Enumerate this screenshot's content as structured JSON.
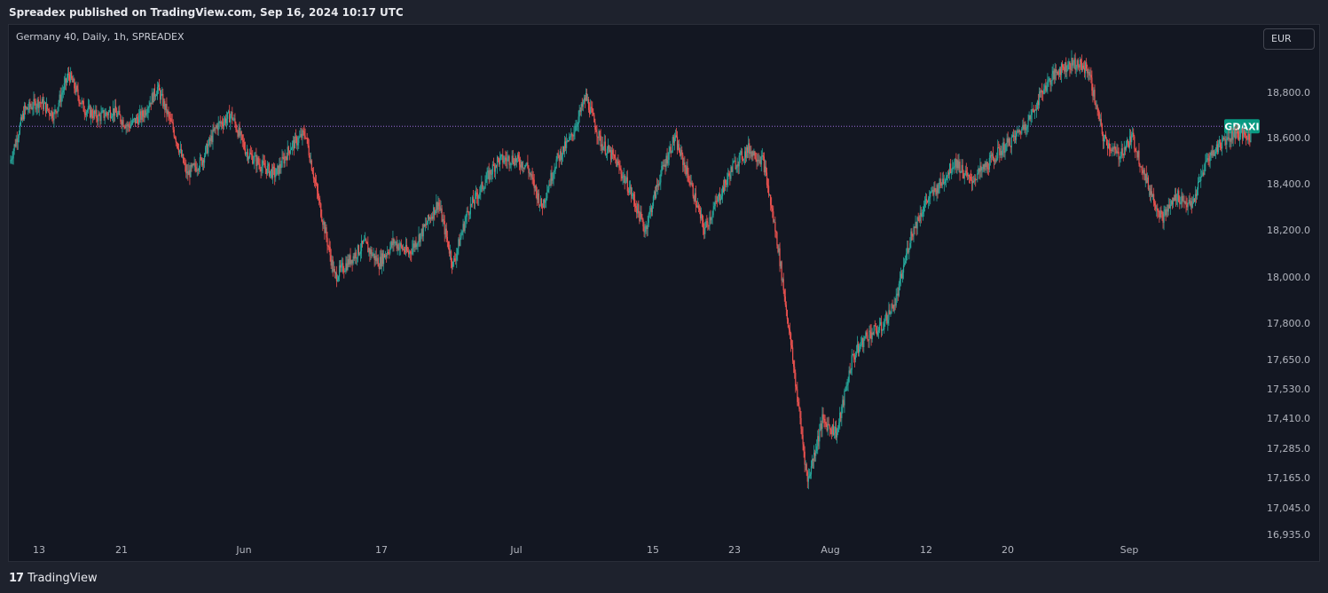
{
  "header": {
    "publisher_line": "Spreadex published on TradingView.com, Sep 16, 2024 10:17 UTC"
  },
  "symbol_info": "Germany 40, Daily, 1h, SPREADEX",
  "currency": "EUR",
  "footer": {
    "logo_glyph": "17",
    "brand": "TradingView"
  },
  "colors": {
    "up": "#26a69a",
    "down": "#ef5350",
    "background": "#131722",
    "price_line": "#9c6ade",
    "tag": "#089981"
  },
  "chart_data": {
    "type": "line",
    "series": [
      {
        "label_tag": "GDAXI",
        "x": [
          "May 10",
          "May 13",
          "May 15",
          "May 17",
          "May 20",
          "May 21",
          "May 22",
          "May 24",
          "May 27",
          "May 28",
          "May 29",
          "May 30",
          "May 31",
          "Jun 3",
          "Jun 5",
          "Jun 6",
          "Jun 7",
          "Jun 10",
          "Jun 11",
          "Jun 12",
          "Jun 13",
          "Jun 14",
          "Jun 17",
          "Jun 18",
          "Jun 20",
          "Jun 21",
          "Jun 24",
          "Jun 26",
          "Jun 28",
          "Jul 1",
          "Jul 2",
          "Jul 3",
          "Jul 4",
          "Jul 5",
          "Jul 8",
          "Jul 9",
          "Jul 10",
          "Jul 11",
          "Jul 12",
          "Jul 15",
          "Jul 16",
          "Jul 17",
          "Jul 18",
          "Jul 19",
          "Jul 22",
          "Jul 23",
          "Jul 24",
          "Jul 25",
          "Jul 26",
          "Jul 29",
          "Jul 30",
          "Jul 31",
          "Aug 1",
          "Aug 2",
          "Aug 5",
          "Aug 6",
          "Aug 7",
          "Aug 8",
          "Aug 9",
          "Aug 12",
          "Aug 13",
          "Aug 14",
          "Aug 15",
          "Aug 16",
          "Aug 19",
          "Aug 20",
          "Aug 21",
          "Aug 22",
          "Aug 23",
          "Aug 26",
          "Aug 27",
          "Aug 28",
          "Aug 29",
          "Aug 30",
          "Sep 2",
          "Sep 3",
          "Sep 4",
          "Sep 5",
          "Sep 6",
          "Sep 9",
          "Sep 10",
          "Sep 11",
          "Sep 12",
          "Sep 13",
          "Sep 16"
        ],
        "y": [
          18490,
          18720,
          18760,
          18700,
          18880,
          18730,
          18690,
          18720,
          18650,
          18700,
          18820,
          18650,
          18440,
          18500,
          18650,
          18700,
          18540,
          18480,
          18440,
          18560,
          18620,
          18300,
          18000,
          18070,
          18140,
          18060,
          18150,
          18100,
          18200,
          18320,
          18050,
          18280,
          18390,
          18500,
          18510,
          18480,
          18300,
          18500,
          18600,
          18780,
          18580,
          18500,
          18370,
          18200,
          18430,
          18600,
          18420,
          18200,
          18340,
          18480,
          18550,
          18500,
          18130,
          17650,
          17150,
          17400,
          17350,
          17650,
          17750,
          17780,
          17900,
          18180,
          18320,
          18400,
          18500,
          18410,
          18470,
          18540,
          18600,
          18680,
          18820,
          18900,
          18930,
          18900,
          18600,
          18520,
          18600,
          18400,
          18250,
          18350,
          18300,
          18500,
          18580,
          18620,
          18600
        ]
      }
    ],
    "current_price": 18650,
    "xticks": [
      "13",
      "21",
      "Jun",
      "17",
      "Jul",
      "15",
      "23",
      "Aug",
      "12",
      "20",
      "Sep"
    ],
    "yticks": [
      "18,800.0",
      "18,600.0",
      "18,400.0",
      "18,200.0",
      "18,000.0",
      "17,800.0",
      "17,650.0",
      "17,530.0",
      "17,410.0",
      "17,285.0",
      "17,165.0",
      "17,045.0",
      "16,935.0"
    ],
    "ylabel_side": "right",
    "grid": false
  }
}
